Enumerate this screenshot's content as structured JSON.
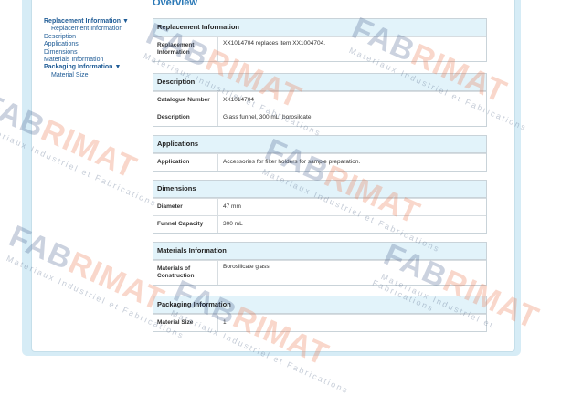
{
  "nav": {
    "items": [
      {
        "label": "Replacement Information",
        "level": 1,
        "expanded": true
      },
      {
        "label": "Replacement Information",
        "level": 2
      },
      {
        "label": "Description",
        "level": 1
      },
      {
        "label": "Applications",
        "level": 1
      },
      {
        "label": "Dimensions",
        "level": 1
      },
      {
        "label": "Materials Information",
        "level": 1
      },
      {
        "label": "Packaging Information",
        "level": 1,
        "expanded": true
      },
      {
        "label": "Material Size",
        "level": 2
      }
    ],
    "caret_icon": "caret-down-icon"
  },
  "overview_title": "Overview",
  "sections": [
    {
      "title": "Replacement Information",
      "rows": [
        {
          "k": "Replacement Information",
          "v": "XX1014704 replaces item XX1004704."
        }
      ]
    },
    {
      "title": "Description",
      "rows": [
        {
          "k": "Catalogue Number",
          "v": "XX1014704"
        },
        {
          "k": "Description",
          "v": "Glass funnel, 300 mL, borosilcate"
        }
      ]
    },
    {
      "title": "Applications",
      "rows": [
        {
          "k": "Application",
          "v": "Accessories for filter holders for sample preparation."
        }
      ]
    },
    {
      "title": "Dimensions",
      "rows": [
        {
          "k": "Diameter",
          "v": "47 mm"
        },
        {
          "k": "Funnel Capacity",
          "v": "300 mL"
        }
      ]
    },
    {
      "title": "Materials Information",
      "rows": [
        {
          "k": "Materials of Construction",
          "v": "Borosilicate glass"
        }
      ]
    },
    {
      "title": "Packaging Information",
      "rows": [
        {
          "k": "Material Size",
          "v": "1"
        }
      ]
    }
  ],
  "watermark": {
    "logo_a": "FAB",
    "logo_b": "RIMAT",
    "tagline": "Materiaux Industriel et Fabrications"
  },
  "colors": {
    "accent": "#2a78b6",
    "link": "#1f5c96",
    "header_bg": "#e2f3fa",
    "frame": "#d6ecf6"
  }
}
